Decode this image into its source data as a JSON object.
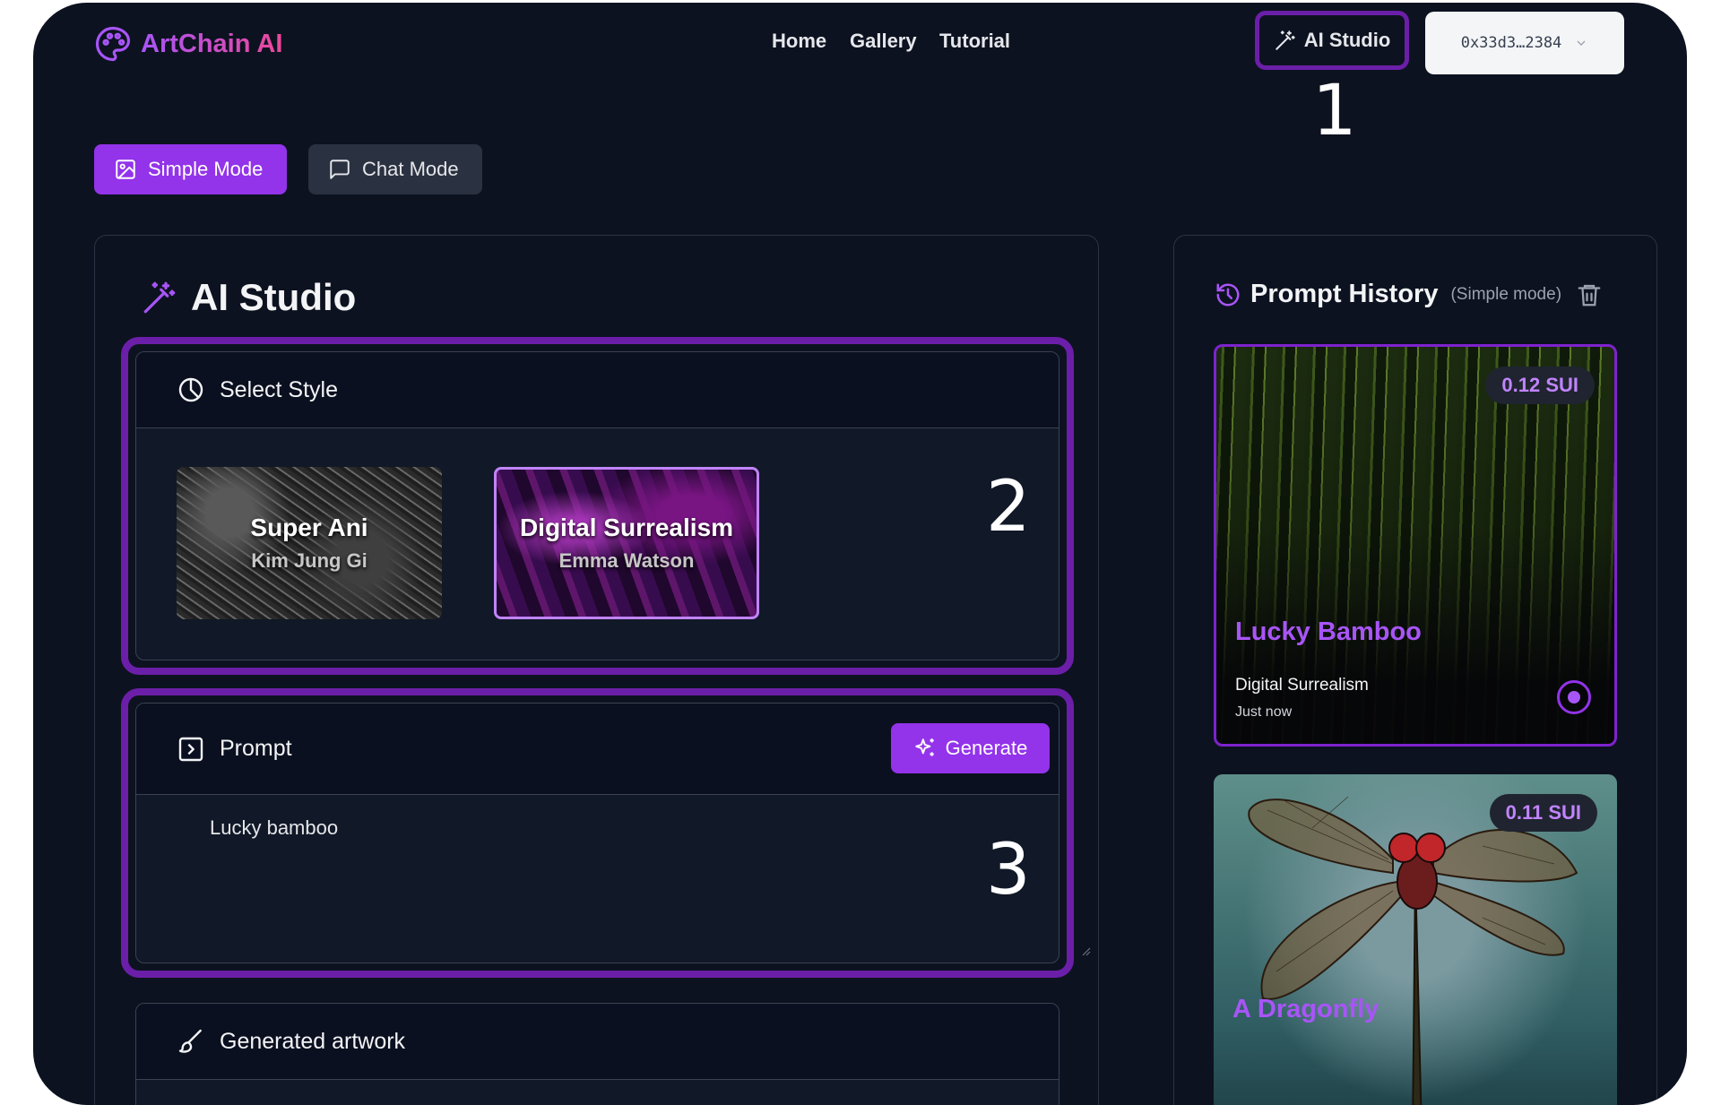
{
  "header": {
    "brand": "ArtChain AI",
    "nav": [
      "Home",
      "Gallery",
      "Tutorial"
    ],
    "studio_link": "AI Studio",
    "wallet": "0x33d3…2384"
  },
  "callouts": [
    "1",
    "2",
    "3"
  ],
  "modes": {
    "simple": "Simple Mode",
    "chat": "Chat Mode",
    "active": "Simple Mode"
  },
  "studio": {
    "title": "AI Studio",
    "select_style": {
      "heading": "Select Style",
      "styles": [
        {
          "name": "Super Ani",
          "author": "Kim Jung Gi",
          "selected": false
        },
        {
          "name": "Digital Surrealism",
          "author": "Emma Watson",
          "selected": true
        }
      ]
    },
    "prompt": {
      "heading": "Prompt",
      "generate_label": "Generate",
      "value": "Lucky bamboo"
    },
    "generated": {
      "heading": "Generated artwork"
    }
  },
  "history": {
    "title": "Prompt History",
    "subtitle": "(Simple mode)",
    "items": [
      {
        "price": "0.12 SUI",
        "name": "Lucky Bamboo",
        "style": "Digital Surrealism",
        "time": "Just now",
        "selected": true
      },
      {
        "price": "0.11 SUI",
        "name": "A Dragonfly"
      }
    ]
  },
  "colors": {
    "accent": "#9333ea",
    "highlight": "#6b1fa8",
    "background": "#0d1220"
  },
  "icons": [
    "palette-icon",
    "magic-wand-icon",
    "chevron-down-icon",
    "image-icon",
    "chat-bubble-icon",
    "pie-chart-icon",
    "terminal-icon",
    "sparkles-icon",
    "brush-icon",
    "history-icon",
    "trash-icon"
  ]
}
